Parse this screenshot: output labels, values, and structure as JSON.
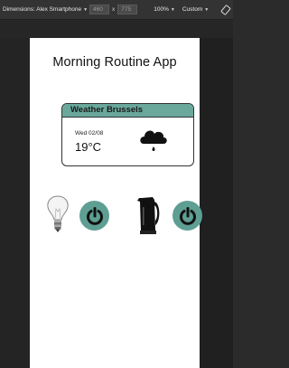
{
  "devtools": {
    "device_label": "Dimensions: Alex Smartphone",
    "width_value": "460",
    "times": "x",
    "height_value": "775",
    "zoom": "100%",
    "throttle": "Custom"
  },
  "app": {
    "title": "Morning Routine App"
  },
  "weather_card": {
    "header": "Weather Brussels",
    "date": "Wed 02/08",
    "temperature": "19°C",
    "condition_icon": "rain-cloud-icon"
  },
  "devices": [
    {
      "name": "lamp",
      "icon": "light-bulb-icon",
      "button": "power-icon"
    },
    {
      "name": "kettle",
      "icon": "kettle-icon",
      "button": "power-icon"
    }
  ],
  "colors": {
    "accent": "#6aa89c",
    "button": "#5e9e93",
    "devtools_bg": "#333333",
    "page_bg": "#ffffff"
  }
}
